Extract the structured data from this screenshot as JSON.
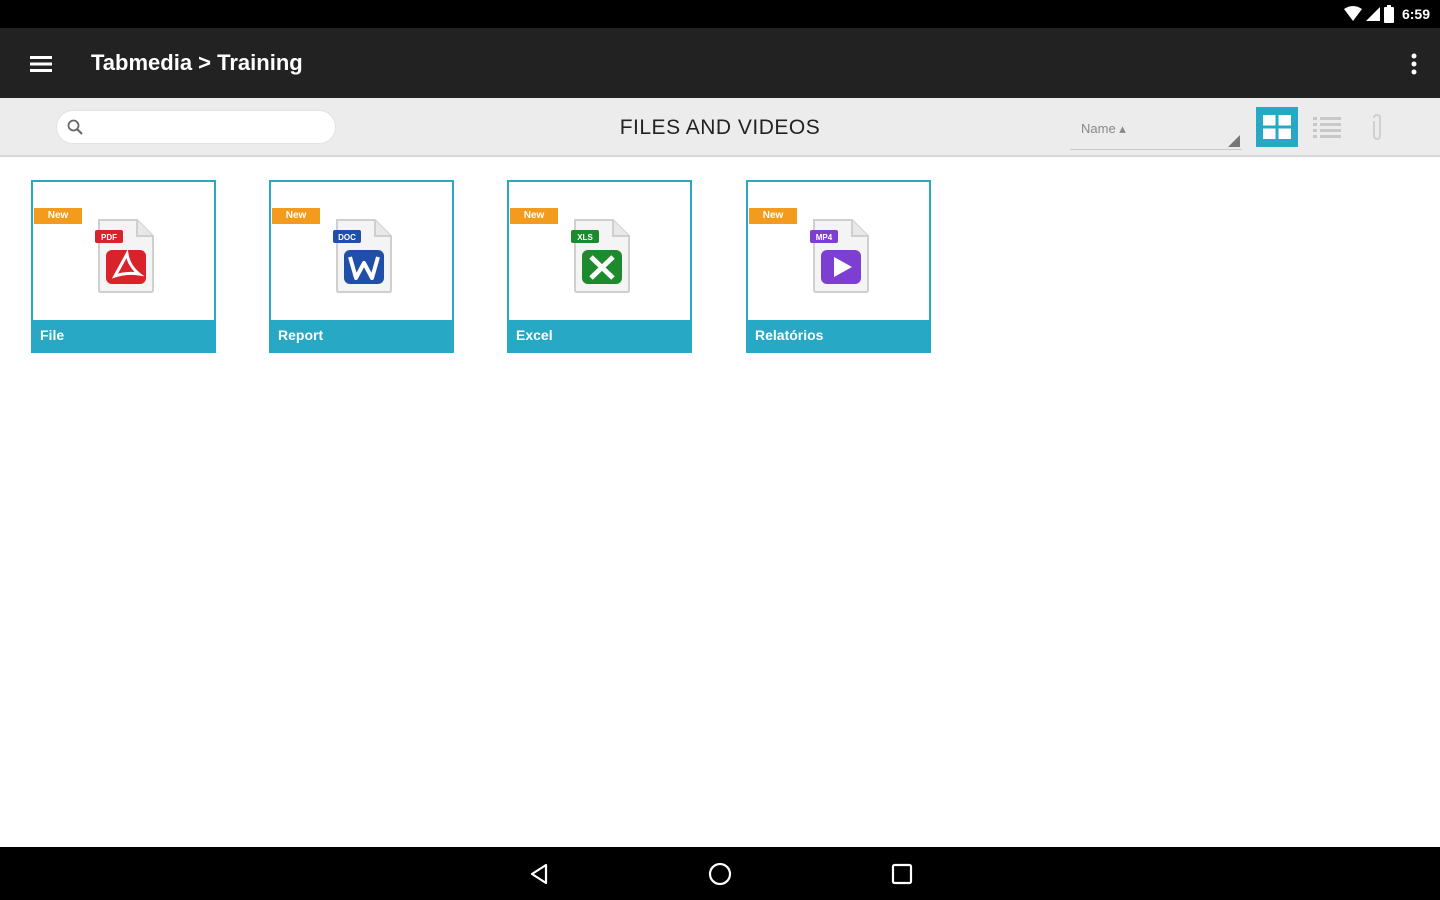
{
  "status_bar": {
    "time": "6:59"
  },
  "app_bar": {
    "breadcrumb": "Tabmedia > Training"
  },
  "toolbar": {
    "search_placeholder": "",
    "section_title": "FILES AND VIDEOS",
    "sort_label": "Name ▴"
  },
  "colors": {
    "accent": "#27a9c6",
    "badge": "#f39b1c",
    "app_bar": "#222222",
    "toolbar": "#ececec"
  },
  "tiles": [
    {
      "badge": "New",
      "file_type": "PDF",
      "icon": "pdf-file-icon",
      "label": "File",
      "color": "#d9232b"
    },
    {
      "badge": "New",
      "file_type": "DOC",
      "icon": "word-file-icon",
      "label": "Report",
      "color": "#1f4fa8"
    },
    {
      "badge": "New",
      "file_type": "XLS",
      "icon": "excel-file-icon",
      "label": "Excel",
      "color": "#1e8a2e"
    },
    {
      "badge": "New",
      "file_type": "MP4",
      "icon": "video-file-icon",
      "label": "Relatórios",
      "color": "#7d3fd1"
    }
  ]
}
